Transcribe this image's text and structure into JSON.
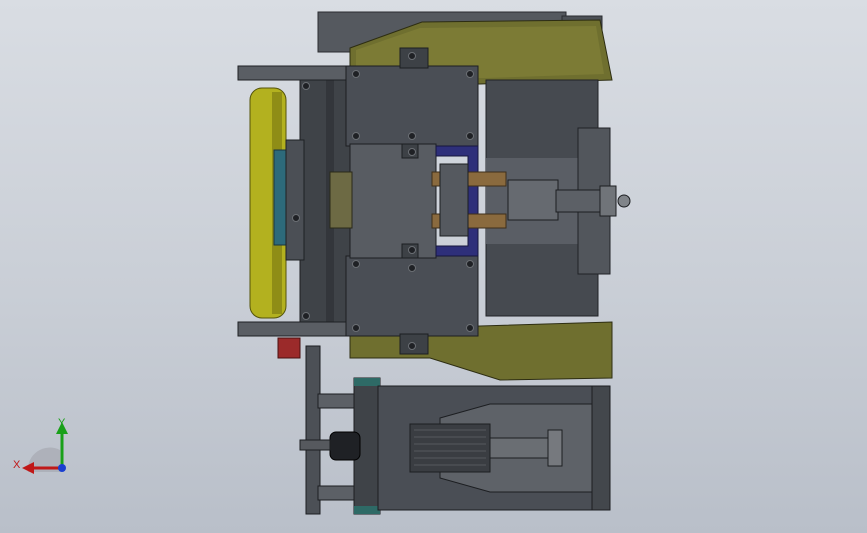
{
  "viewport": {
    "background_top": "#d9dde3",
    "background_bottom": "#b9bfc9"
  },
  "model": {
    "colors": {
      "housing": "#4a4e55",
      "housing_dark": "#3a3d42",
      "olive_frame": "#6f6f2f",
      "olive_highlight": "#8b8a3c",
      "roller_yellow": "#b3b11f",
      "accent_blue": "#2e2f7a",
      "accent_red": "#9b2a2a",
      "bolt": "#1f2125"
    }
  },
  "triad": {
    "x_label": "X",
    "y_label": "Y",
    "x_color": "#c01818",
    "y_color": "#19a019",
    "z_color": "#1a3fd0"
  }
}
